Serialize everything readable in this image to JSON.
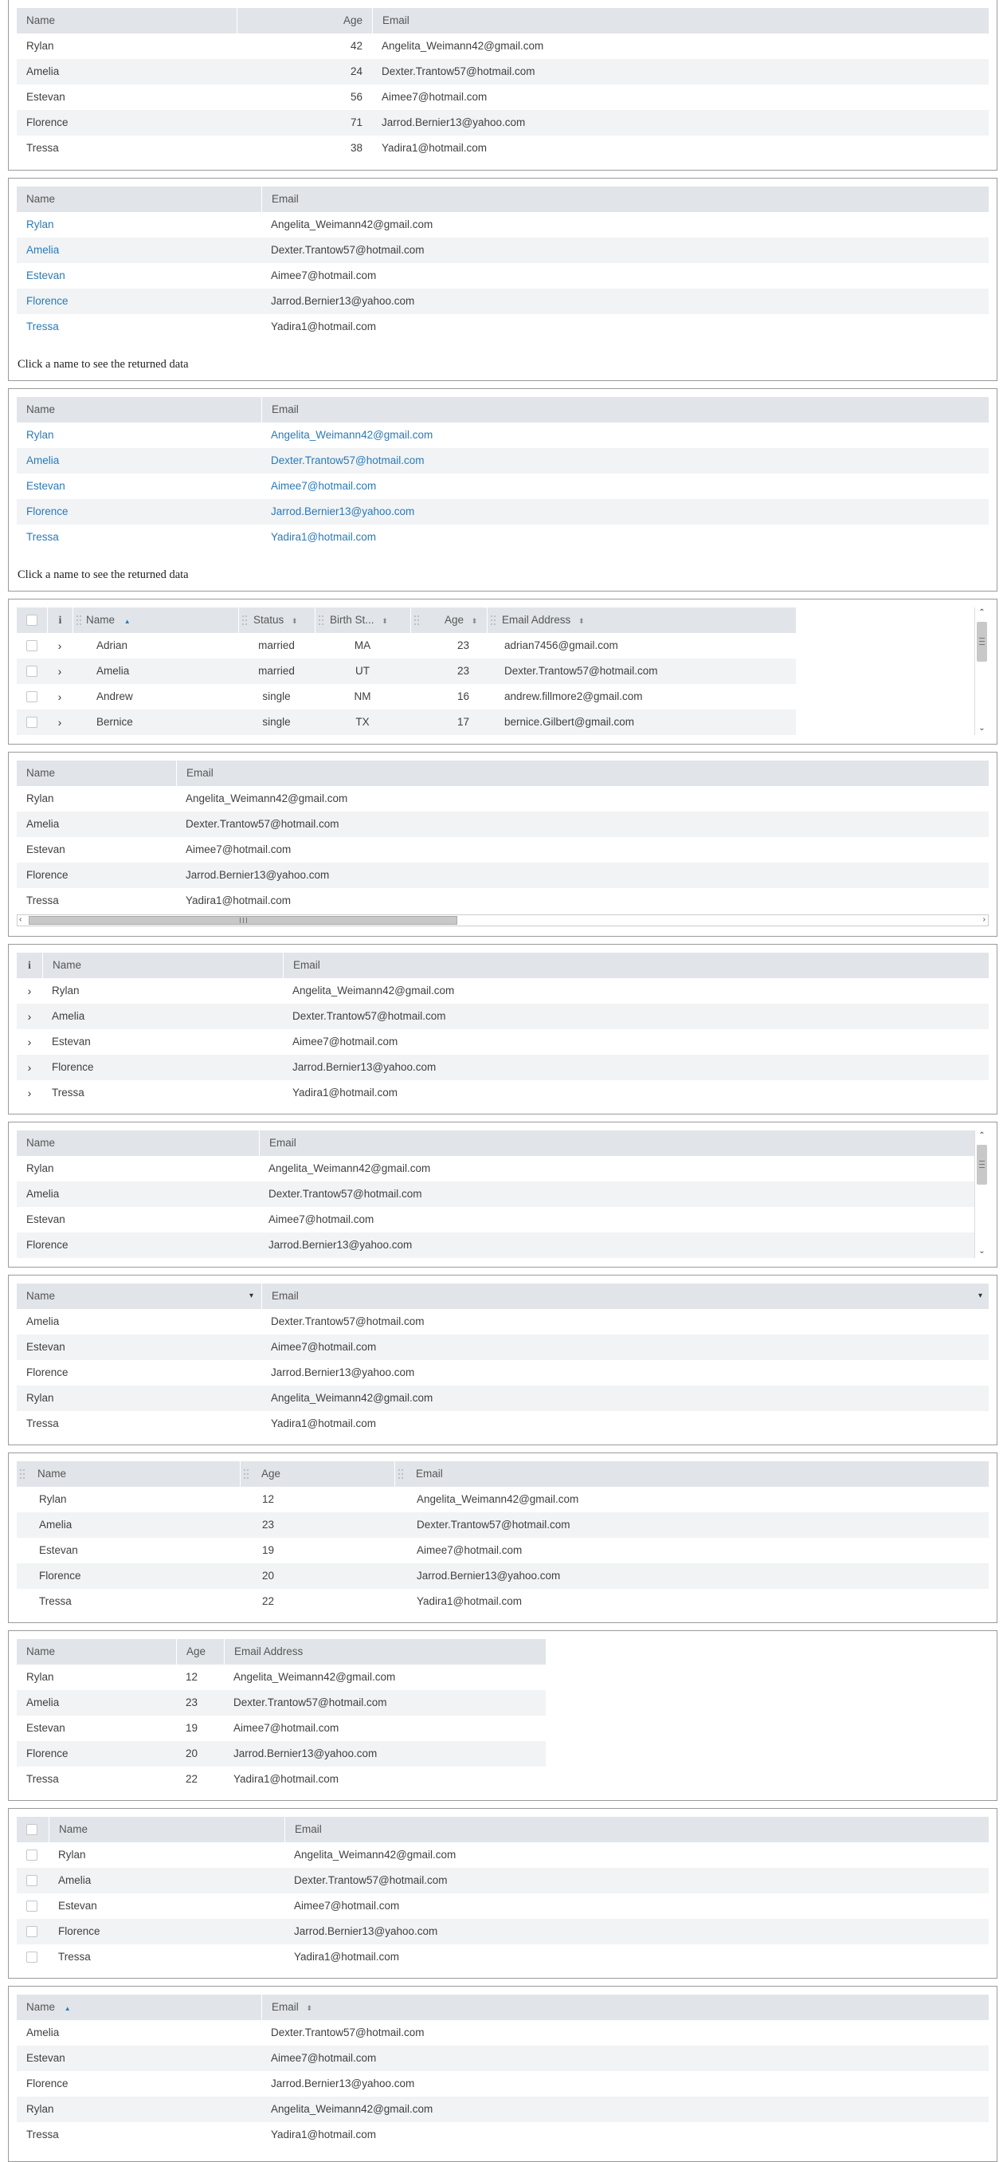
{
  "common": {
    "names": [
      "Rylan",
      "Amelia",
      "Estevan",
      "Florence",
      "Tressa"
    ],
    "emails": [
      "Angelita_Weimann42@gmail.com",
      "Dexter.Trantow57@hotmail.com",
      "Aimee7@hotmail.com",
      "Jarrod.Bernier13@yahoo.com",
      "Yadira1@hotmail.com"
    ],
    "col_name": "Name",
    "col_email": "Email",
    "col_age": "Age",
    "col_email_address": "Email Address",
    "info_glyph": "i",
    "chevron_right_icon": "›",
    "sort_up_icon": "▲",
    "sort_both_icon": "⬍",
    "dropdown_icon": "▾",
    "click_caption": "Click a name to see the returned data"
  },
  "table1": {
    "rows": [
      {
        "name": "Rylan",
        "age": "42",
        "email": "Angelita_Weimann42@gmail.com"
      },
      {
        "name": "Amelia",
        "age": "24",
        "email": "Dexter.Trantow57@hotmail.com"
      },
      {
        "name": "Estevan",
        "age": "56",
        "email": "Aimee7@hotmail.com"
      },
      {
        "name": "Florence",
        "age": "71",
        "email": "Jarrod.Bernier13@yahoo.com"
      },
      {
        "name": "Tressa",
        "age": "38",
        "email": "Yadira1@hotmail.com"
      }
    ]
  },
  "table4": {
    "headers": {
      "name": "Name",
      "status": "Status",
      "birth": "Birth St...",
      "age": "Age",
      "email": "Email Address"
    },
    "rows": [
      {
        "name": "Adrian",
        "status": "married",
        "birth": "MA",
        "age": "23",
        "email": "adrian7456@gmail.com"
      },
      {
        "name": "Amelia",
        "status": "married",
        "birth": "UT",
        "age": "23",
        "email": "Dexter.Trantow57@hotmail.com"
      },
      {
        "name": "Andrew",
        "status": "single",
        "birth": "NM",
        "age": "16",
        "email": "andrew.fillmore2@gmail.com"
      },
      {
        "name": "Bernice",
        "status": "single",
        "birth": "TX",
        "age": "17",
        "email": "bernice.Gilbert@gmail.com"
      }
    ]
  },
  "table8": {
    "rows": [
      {
        "name": "Amelia",
        "email": "Dexter.Trantow57@hotmail.com"
      },
      {
        "name": "Estevan",
        "email": "Aimee7@hotmail.com"
      },
      {
        "name": "Florence",
        "email": "Jarrod.Bernier13@yahoo.com"
      },
      {
        "name": "Rylan",
        "email": "Angelita_Weimann42@gmail.com"
      },
      {
        "name": "Tressa",
        "email": "Yadira1@hotmail.com"
      }
    ]
  },
  "table9": {
    "rows": [
      {
        "name": "Rylan",
        "age": "12",
        "email": "Angelita_Weimann42@gmail.com"
      },
      {
        "name": "Amelia",
        "age": "23",
        "email": "Dexter.Trantow57@hotmail.com"
      },
      {
        "name": "Estevan",
        "age": "19",
        "email": "Aimee7@hotmail.com"
      },
      {
        "name": "Florence",
        "age": "20",
        "email": "Jarrod.Bernier13@yahoo.com"
      },
      {
        "name": "Tressa",
        "age": "22",
        "email": "Yadira1@hotmail.com"
      }
    ]
  },
  "table12": {
    "rows": [
      {
        "name": "Amelia",
        "email": "Dexter.Trantow57@hotmail.com"
      },
      {
        "name": "Estevan",
        "email": "Aimee7@hotmail.com"
      },
      {
        "name": "Florence",
        "email": "Jarrod.Bernier13@yahoo.com"
      },
      {
        "name": "Rylan",
        "email": "Angelita_Weimann42@gmail.com"
      },
      {
        "name": "Tressa",
        "email": "Yadira1@hotmail.com"
      }
    ]
  },
  "colors": {
    "header_bg": "#e1e5e9",
    "alt_row": "#f1f3f5",
    "link": "#2a7ab8",
    "border": "#9a9a9a"
  }
}
